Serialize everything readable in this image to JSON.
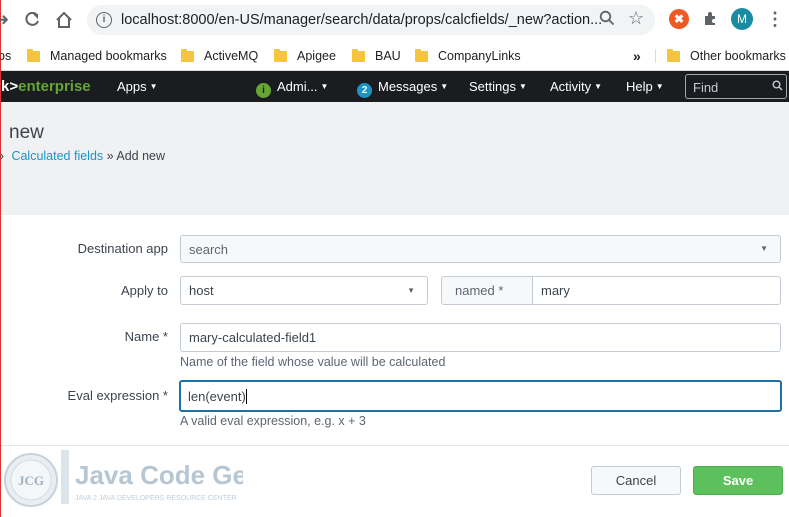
{
  "browser": {
    "url": "localhost:8000/en-US/manager/search/data/props/calcfields/_new?action...",
    "avatar_letter": "M",
    "bookmarks_prefix": "ps",
    "bookmarks": [
      "Managed bookmarks",
      "ActiveMQ",
      "Apigee",
      "BAU",
      "CompanyLinks"
    ],
    "more_bookmarks": "»",
    "other_bookmarks": "Other bookmarks"
  },
  "appbar": {
    "logo_prefix": "k>",
    "logo_suffix": "enterprise",
    "apps": "Apps",
    "admin": "Admi...",
    "messages_count": "2",
    "messages": "Messages",
    "settings": "Settings",
    "activity": "Activity",
    "help": "Help",
    "find_placeholder": "Find"
  },
  "header": {
    "title": "new",
    "crumb_link": "Calculated fields",
    "crumb_sep": "»",
    "crumb_current": "Add new"
  },
  "form": {
    "destination_label": "Destination app",
    "destination_value": "search",
    "apply_label": "Apply to",
    "apply_value": "host",
    "named_label": "named *",
    "named_value": "mary",
    "name_label": "Name *",
    "name_value": "mary-calculated-field1",
    "name_help": "Name of the field whose value will be calculated",
    "eval_label": "Eval expression *",
    "eval_value": "len(event)",
    "eval_help": "A valid eval expression, e.g. x + 3"
  },
  "footer": {
    "cancel": "Cancel",
    "save": "Save"
  },
  "watermark": {
    "badge": "JCG",
    "name": "Java Code Geeks",
    "tagline": "JAVA 2 JAVA DEVELOPERS RESOURCE CENTER"
  },
  "colors": {
    "accent_green": "#65a637",
    "link_blue": "#1e93c6",
    "save_green": "#5cc05c",
    "focus_blue": "#1e6fa3"
  }
}
